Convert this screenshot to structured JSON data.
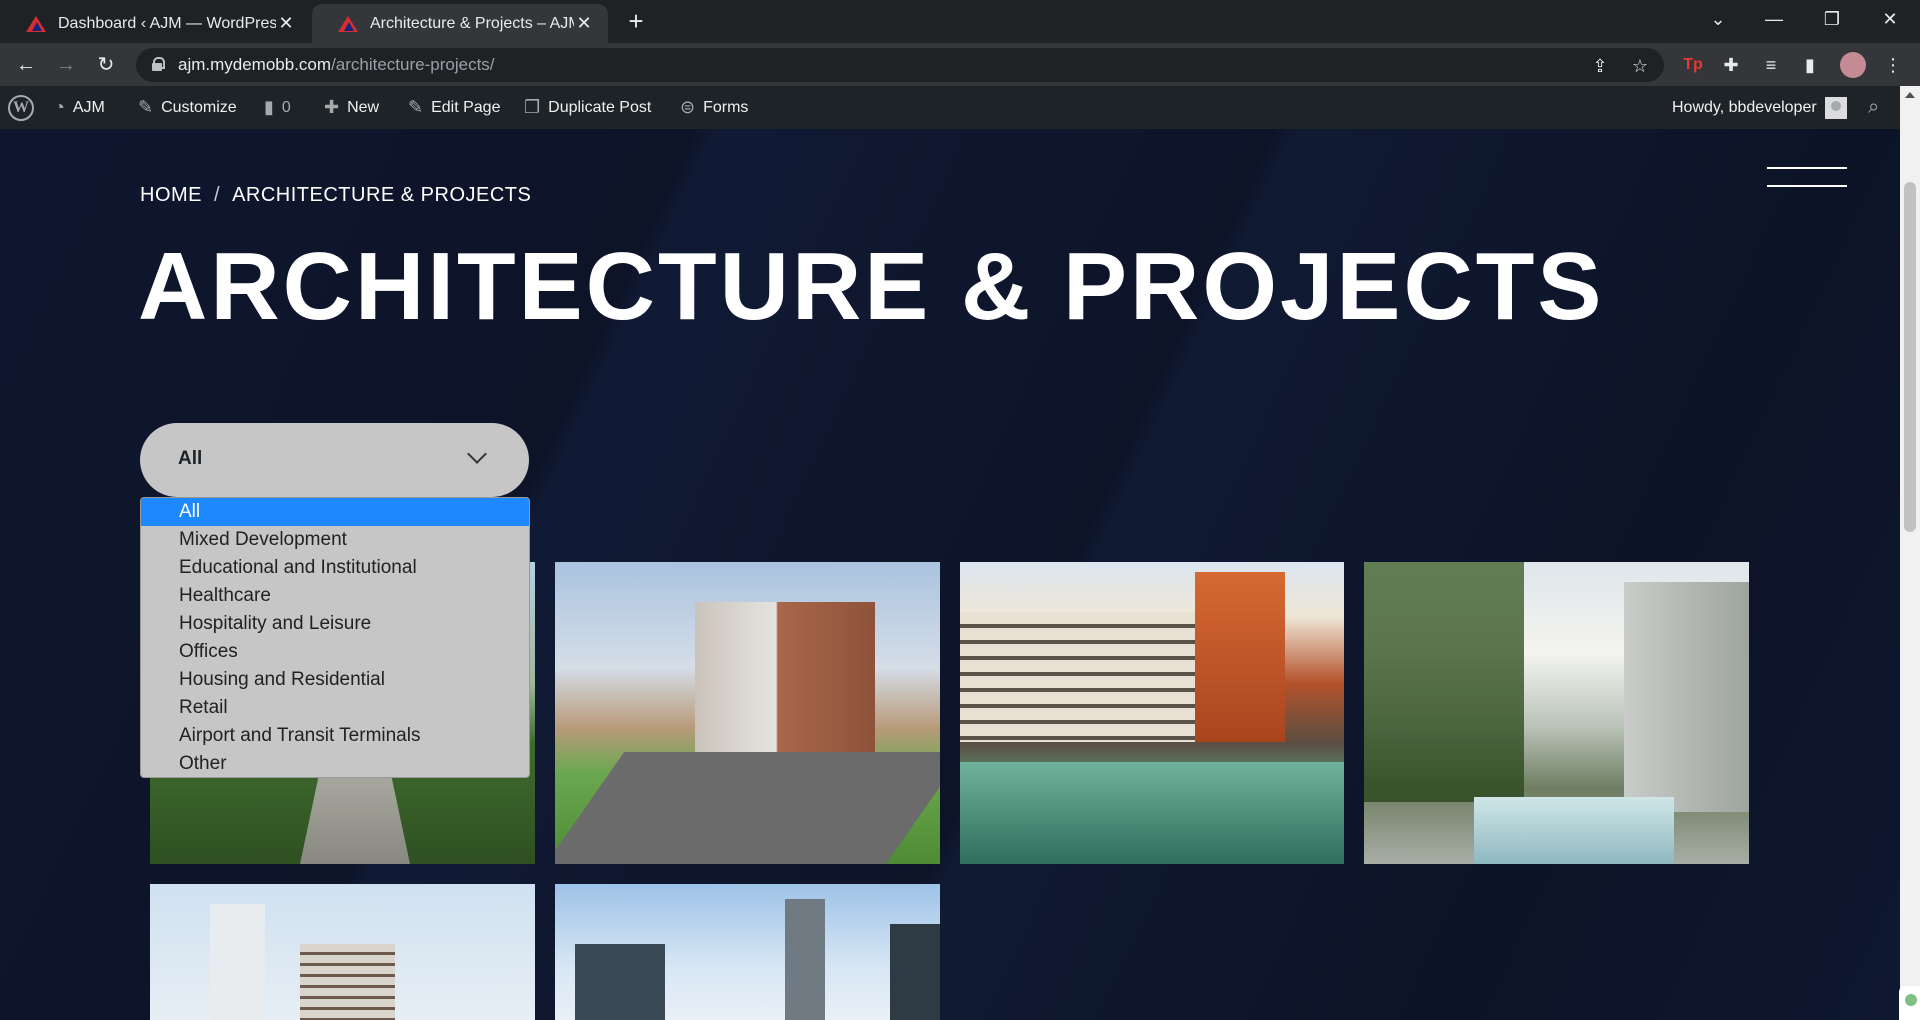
{
  "browser": {
    "tabs": [
      {
        "title": "Dashboard ‹ AJM — WordPress",
        "active": false
      },
      {
        "title": "Architecture & Projects – AJM",
        "active": true
      }
    ],
    "new_tab_glyph": "+",
    "url_host": "ajm.mydemobb.com",
    "url_path": "/architecture-projects/",
    "window_controls": {
      "minimize": "—",
      "maximize": "❐",
      "close": "✕",
      "tab_search": "⌄"
    },
    "extension_tp_label": "Tp"
  },
  "adminbar": {
    "site_name": "AJM",
    "customize": "Customize",
    "comments_count": "0",
    "new_label": "New",
    "edit_page": "Edit Page",
    "duplicate_post": "Duplicate Post",
    "forms": "Forms",
    "howdy": "Howdy, bbdeveloper"
  },
  "page": {
    "breadcrumb": {
      "home": "HOME",
      "separator": "/",
      "current": "ARCHITECTURE & PROJECTS"
    },
    "title": "ARCHITECTURE & PROJECTS",
    "filter": {
      "selected": "All",
      "options": [
        "All",
        "Mixed Development",
        "Educational and Institutional",
        "Healthcare",
        "Hospitality and Leisure",
        "Offices",
        "Housing and Residential",
        "Retail",
        "Airport and Transit Terminals",
        "Other"
      ]
    }
  },
  "colors": {
    "page_bg": "#0d1428",
    "adminbar_bg": "#1d2327",
    "select_bg": "#c6c6c6",
    "option_highlight": "#1e88ff"
  }
}
